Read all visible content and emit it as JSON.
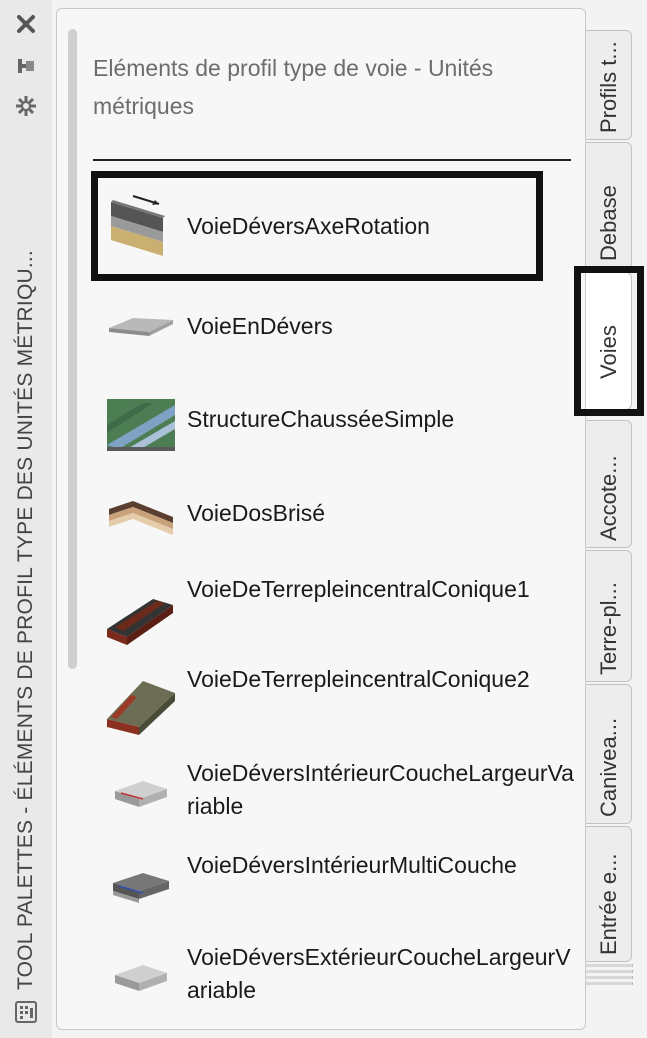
{
  "palette_window": {
    "title": "TOOL PALETTES - ÉLÉMENTS DE PROFIL TYPE DES UNITÉS MÉTRIQU...",
    "controls": [
      {
        "name": "close-icon",
        "glyph": "✖"
      },
      {
        "name": "pin-icon",
        "glyph": "⇥"
      },
      {
        "name": "properties-icon",
        "glyph": "✲"
      }
    ],
    "menu_icon": "palette-menu-icon"
  },
  "palette": {
    "header": "Eléments de profil type de voie - Unités métriques",
    "tools": [
      {
        "label": "VoieDéversAxeRotation",
        "icon": "lane-superelevation-axis-icon",
        "selected": true
      },
      {
        "label": "VoieEnDévers",
        "icon": "lane-superelevation-icon"
      },
      {
        "label": "StructureChausséeSimple",
        "icon": "pavement-structure-icon"
      },
      {
        "label": "VoieDosBrisé",
        "icon": "lane-broken-back-icon"
      },
      {
        "label": "VoieDeTerrepleincentralConique1",
        "icon": "median-conic-1-icon"
      },
      {
        "label": "VoieDeTerrepleincentralConique2",
        "icon": "median-conic-2-icon"
      },
      {
        "label": "VoieDéversIntérieurCoucheLargeurVariable",
        "icon": "inside-variable-width-icon"
      },
      {
        "label": "VoieDéversIntérieurMultiCouche",
        "icon": "inside-multilayer-icon"
      },
      {
        "label": "VoieDéversExtérieurCoucheLargeurVariable",
        "icon": "outside-variable-width-icon"
      }
    ]
  },
  "tabs": [
    {
      "label": "Profils t...",
      "active": false
    },
    {
      "label": "Debase",
      "active": false
    },
    {
      "label": "Voies",
      "active": true
    },
    {
      "label": "Accote...",
      "active": false
    },
    {
      "label": "Terre-pl...",
      "active": false
    },
    {
      "label": "Canivea...",
      "active": false
    },
    {
      "label": "Entrée e...",
      "active": false
    }
  ],
  "colors": {
    "selection_outline": "#111111",
    "header_text": "#6d6d6d",
    "panel_bg": "#f7f7f7"
  }
}
